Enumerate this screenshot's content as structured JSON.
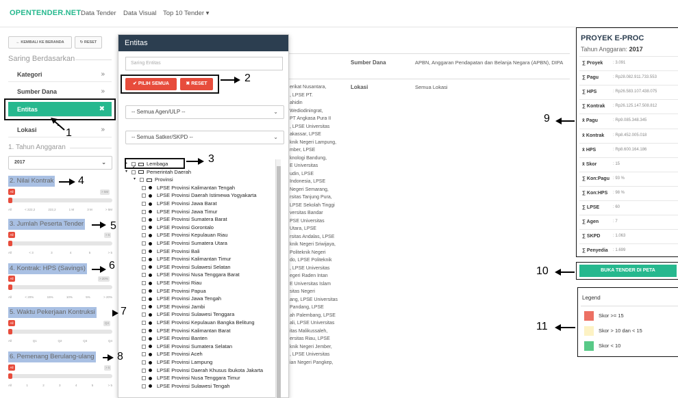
{
  "navbar": {
    "brand": "OPENTENDER.NET",
    "links": [
      "Data Tender",
      "Data Visual",
      "Top 10 Tender ▾"
    ]
  },
  "left": {
    "back_button": "← KEMBALI KE BERANDA",
    "reset_button": "↻ RESET",
    "filter_heading": "Saring Berdasarkan",
    "filters": [
      {
        "label": "Kategori",
        "icon": "»"
      },
      {
        "label": "Sumber Dana",
        "icon": "»"
      },
      {
        "label": "Entitas",
        "icon": "✖"
      },
      {
        "label": "Lokasi",
        "icon": "»"
      }
    ],
    "year_heading": "1. Tahun Anggaran",
    "year_value": "2017",
    "sliders": [
      {
        "label": "2. Nilai Kontrak",
        "max": "> 5M",
        "ticks": [
          "All",
          "< 222,2",
          "222,2",
          "1 M",
          "3 M",
          "> 5M"
        ]
      },
      {
        "label": "3. Jumlah Peserta Tender",
        "max": "> 5",
        "ticks": [
          "All",
          "< 3",
          "3",
          "4",
          "5",
          "> 5"
        ]
      },
      {
        "label": "4. Kontrak: HPS (Savings)",
        "max": "> 20%",
        "ticks": [
          "All",
          "< 20%",
          "15%",
          "10%",
          "5%",
          "> 20%"
        ]
      },
      {
        "label": "5. Waktu Pekerjaan Kontruksi",
        "max": "Q4",
        "ticks": [
          "All",
          "Q1",
          "Q2",
          "Q3",
          "Q4"
        ]
      },
      {
        "label": "6. Pemenang Berulang-ulang",
        "max": "> 5",
        "ticks": [
          "All",
          "1",
          "2",
          "3",
          "4",
          "5",
          "> 5"
        ]
      }
    ],
    "all_badge": "All"
  },
  "background_table": {
    "col1_header": "Sumber Dana",
    "col1_value": "APBN, Anggaran Pendapatan dan Belanja Negara (APBN), DIPA",
    "col2_header": "Lokasi",
    "col2_value": "Semua Lokasi",
    "entitas_lines": [
      "erikat Nusantara,",
      ", LPSE PT.",
      "ahidin",
      "Wediodiningrat,",
      "PT Angkasa Pura II",
      ", LPSE Universitas",
      "akassar, LPSE",
      "knik Negeri Lampung,",
      "mber, LPSE",
      "knologi Bandung,",
      "E Universitas",
      "udin, LPSE",
      "Indonesia, LPSE",
      "Negeri Semarang,",
      "rsitas Tanjung Pura,",
      "LPSE Sekolah Tinggi",
      "versitas Bandar",
      "PSE Universitas",
      "Utara, LPSE",
      "rsitas Andalas, LPSE",
      "knik Negeri Sriwijaya,",
      "Politeknik Negeri",
      "do, LPSE Politeknik",
      ", LPSE Universitas",
      "egeri Raden Intan",
      "E Universitas Islam",
      "sitas Negeri",
      "ang, LPSE Universitas",
      "Pandang, LPSE",
      "ah Palembang, LPSE",
      "ali, LPSE Universitas",
      "itas Malikussaleh,",
      "ersitas Riau, LPSE",
      "knik Negeri Jember,",
      ", LPSE Universitas",
      "ian Negeri Pangkep,"
    ]
  },
  "modal": {
    "title": "Entitas",
    "search_placeholder": "Saring Entitas",
    "select_all": "✔ PILIH SEMUA",
    "reset": "✖ RESET",
    "agen_select": "-- Semua Agen/ULP --",
    "satker_select": "-- Semua Satker/SKPD --",
    "tree_root": "Lembaga",
    "tree_pemda": "Pemerintah Daerah",
    "tree_provinsi": "Provinsi",
    "provinces": [
      "LPSE Provinsi Kalimantan Tengah",
      "LPSE Provinsi Daerah Istimewa Yogyakarta",
      "LPSE Provinsi Jawa Barat",
      "LPSE Provinsi Jawa Timur",
      "LPSE Provinsi Sumatera Barat",
      "LPSE Provinsi Gorontalo",
      "LPSE Provinsi Kepulauan Riau",
      "LPSE Provinsi Sumatera Utara",
      "LPSE Provinsi Bali",
      "LPSE Provinsi Kalimantan Timur",
      "LPSE Provinsi Sulawesi Selatan",
      "LPSE Provinsi Nusa Tenggara Barat",
      "LPSE Provinsi Riau",
      "LPSE Provinsi Papua",
      "LPSE Provinsi Jawa Tengah",
      "LPSE Provinsi Jambi",
      "LPSE Provinsi Sulawesi Tenggara",
      "LPSE Provinsi Kepulauan Bangka Belitung",
      "LPSE Provinsi Kalimantan Barat",
      "LPSE Provinsi Banten",
      "LPSE Provinsi Sumatera Selatan",
      "LPSE Provinsi Aceh",
      "LPSE Provinsi Lampung",
      "LPSE Provinsi Daerah Khusus Ibukota Jakarta",
      "LPSE Provinsi Nusa Tenggara Timur",
      "LPSE Provinsi Sulawesi Tengah"
    ]
  },
  "right": {
    "title": "PROYEK E-PROC",
    "year_label": "Tahun Anggaran:",
    "year": "2017",
    "stats": [
      {
        "label": "∑ Proyek",
        "value": ": 3.091"
      },
      {
        "label": "∑ Pagu",
        "value": ": Rp28.082.911.733.553"
      },
      {
        "label": "∑ HPS",
        "value": ": Rp26.583.107.438.075"
      },
      {
        "label": "∑ Kontrak",
        "value": ": Rp26.125.147.508.812"
      },
      {
        "label": "x̄ Pagu",
        "value": ": Rp9.085.348.345"
      },
      {
        "label": "x̄ Kontrak",
        "value": ": Rp8.452.005.018"
      },
      {
        "label": "x̄ HPS",
        "value": ": Rp8.600.164.186"
      },
      {
        "label": "x̄ Skor",
        "value": ": 15"
      },
      {
        "label": "∑ Kon:Pagu",
        "value": ": 93 %"
      },
      {
        "label": "∑ Kon:HPS",
        "value": ": 98 %"
      },
      {
        "label": "∑ LPSE",
        "value": ": 60"
      },
      {
        "label": "∑ Agen",
        "value": ": 7"
      },
      {
        "label": "∑ SKPD",
        "value": ": 1.063"
      },
      {
        "label": "∑ Penyedia",
        "value": ": 1.699"
      }
    ],
    "map_button": "BUKA TENDER DI PETA",
    "legend_title": "Legend",
    "legend": [
      {
        "label": "Skor >= 15",
        "color": "#ec7063"
      },
      {
        "label": "Skor > 10 dan < 15",
        "color": "#fdf2c4"
      },
      {
        "label": "Skor < 10",
        "color": "#58c987"
      }
    ]
  },
  "callouts": [
    "1",
    "2",
    "3",
    "4",
    "5",
    "6",
    "7",
    "8",
    "9",
    "10",
    "11"
  ]
}
